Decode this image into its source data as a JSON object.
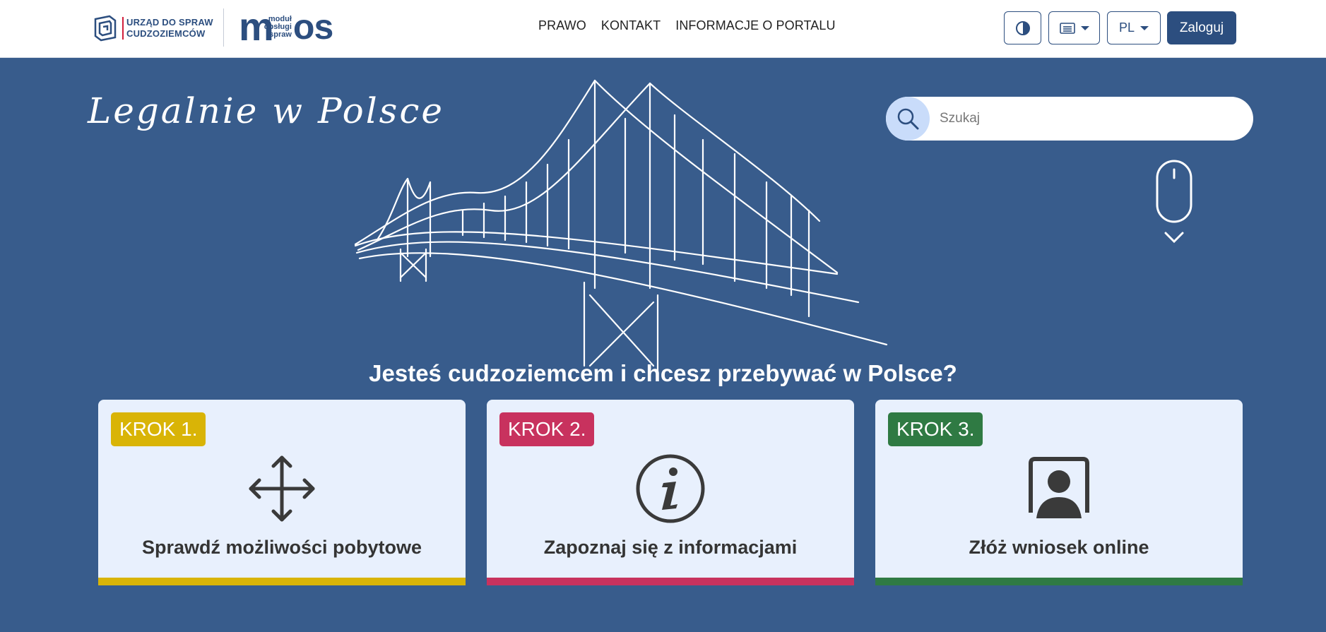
{
  "header": {
    "org_logo_lines": [
      "URZĄD DO SPRAW",
      "CUDZOZIEMCÓW"
    ],
    "mos_logo": {
      "m": "m",
      "small_lines": [
        "moduł",
        "obsługi",
        "spraw"
      ],
      "os": "os"
    },
    "nav": [
      {
        "label": "PRAWO"
      },
      {
        "label": "KONTAKT"
      },
      {
        "label": "INFORMACJE O PORTALU"
      }
    ],
    "contrast_icon": "contrast-icon",
    "view_icon": "list-view-icon",
    "language": "PL",
    "login_label": "Zaloguj"
  },
  "hero": {
    "tagline": "Legalnie w Polsce",
    "search_placeholder": "Szukaj",
    "headline": "Jesteś cudzoziemcem i chcesz przebywać w Polsce?"
  },
  "cards": [
    {
      "badge": "KROK 1.",
      "label": "Sprawdź możliwości pobytowe",
      "icon": "move-arrows-icon",
      "color": "#d9b406"
    },
    {
      "badge": "KROK 2.",
      "label": "Zapoznaj się z informacjami",
      "icon": "info-icon",
      "color": "#c8325e"
    },
    {
      "badge": "KROK 3.",
      "label": "Złóż wniosek online",
      "icon": "user-monitor-icon",
      "color": "#2f7a43"
    }
  ],
  "colors": {
    "brand": "#2c4e7f",
    "hero_background": "#385c8c",
    "card_background": "#e8f0fd"
  }
}
